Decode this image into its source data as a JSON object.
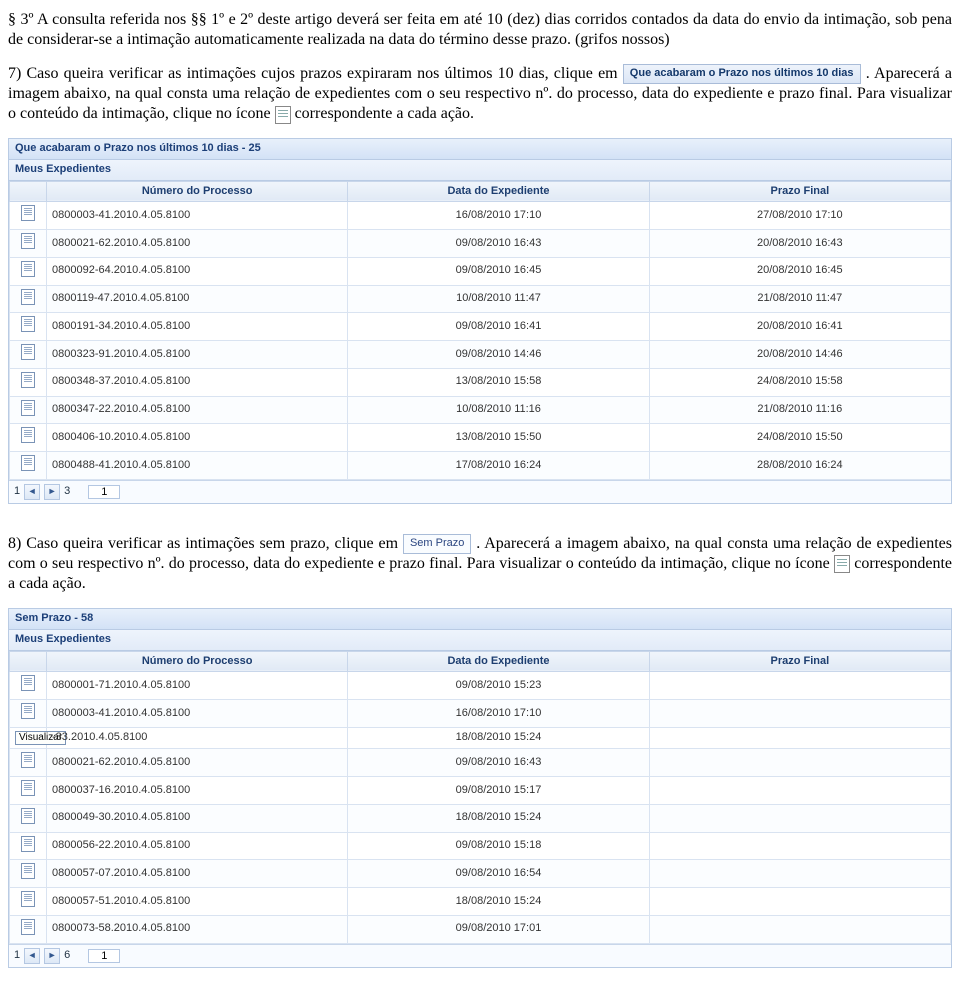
{
  "paragraph1": "§ 3º  A consulta referida nos §§ 1º e 2º deste artigo deverá ser feita em até 10 (dez) dias corridos contados da data do envio da intimação, sob pena de considerar-se a intimação automaticamente realizada na data do término desse prazo. (grifos nossos)",
  "para7_a": "7) Caso queira verificar as intimações cujos prazos expiraram nos últimos 10 dias, clique em ",
  "box_10dias": "Que acabaram o Prazo nos últimos 10 dias",
  "para7_b": ". Aparecerá a imagem abaixo, na qual consta uma relação de expedientes com o seu respectivo nº. do processo, data do expediente e prazo final. Para visualizar o conteúdo da intimação, clique no ícone ",
  "para7_c": " correspondente a cada ação.",
  "panelA": {
    "title": "Que acabaram o Prazo nos últimos 10 dias - 25",
    "sub": "Meus Expedientes",
    "headers": [
      "",
      "Número do Processo",
      "Data do Expediente",
      "Prazo Final"
    ],
    "rows": [
      [
        "0800003-41.2010.4.05.8100",
        "16/08/2010 17:10",
        "27/08/2010 17:10"
      ],
      [
        "0800021-62.2010.4.05.8100",
        "09/08/2010 16:43",
        "20/08/2010 16:43"
      ],
      [
        "0800092-64.2010.4.05.8100",
        "09/08/2010 16:45",
        "20/08/2010 16:45"
      ],
      [
        "0800119-47.2010.4.05.8100",
        "10/08/2010 11:47",
        "21/08/2010 11:47"
      ],
      [
        "0800191-34.2010.4.05.8100",
        "09/08/2010 16:41",
        "20/08/2010 16:41"
      ],
      [
        "0800323-91.2010.4.05.8100",
        "09/08/2010 14:46",
        "20/08/2010 14:46"
      ],
      [
        "0800348-37.2010.4.05.8100",
        "13/08/2010 15:58",
        "24/08/2010 15:58"
      ],
      [
        "0800347-22.2010.4.05.8100",
        "10/08/2010 11:16",
        "21/08/2010 11:16"
      ],
      [
        "0800406-10.2010.4.05.8100",
        "13/08/2010 15:50",
        "24/08/2010 15:50"
      ],
      [
        "0800488-41.2010.4.05.8100",
        "17/08/2010 16:24",
        "28/08/2010 16:24"
      ]
    ],
    "pager": {
      "current": "1",
      "total": "3",
      "input": "1"
    }
  },
  "para8_a": "8) Caso queira verificar as intimações sem prazo, clique em ",
  "box_semprazo": "Sem Prazo",
  "para8_b": ". Aparecerá a imagem abaixo, na qual consta uma relação de expedientes com o seu respectivo nº. do processo, data do expediente e prazo final. Para visualizar o conteúdo da intimação, clique no ícone ",
  "para8_c": " correspondente a cada ação.",
  "panelB": {
    "title": "Sem Prazo - 58",
    "sub": "Meus Expedientes",
    "headers": [
      "",
      "Número do Processo",
      "Data do Expediente",
      "Prazo Final"
    ],
    "tooltip": "Visualizar",
    "rows": [
      [
        "0800001-71.2010.4.05.8100",
        "09/08/2010 15:23",
        ""
      ],
      [
        "0800003-41.2010.4.05.8100",
        "16/08/2010 17:10",
        ""
      ],
      [
        "-33.2010.4.05.8100",
        "18/08/2010 15:24",
        ""
      ],
      [
        "0800021-62.2010.4.05.8100",
        "09/08/2010 16:43",
        ""
      ],
      [
        "0800037-16.2010.4.05.8100",
        "09/08/2010 15:17",
        ""
      ],
      [
        "0800049-30.2010.4.05.8100",
        "18/08/2010 15:24",
        ""
      ],
      [
        "0800056-22.2010.4.05.8100",
        "09/08/2010 15:18",
        ""
      ],
      [
        "0800057-07.2010.4.05.8100",
        "09/08/2010 16:54",
        ""
      ],
      [
        "0800057-51.2010.4.05.8100",
        "18/08/2010 15:24",
        ""
      ],
      [
        "0800073-58.2010.4.05.8100",
        "09/08/2010 17:01",
        ""
      ]
    ],
    "pager": {
      "current": "1",
      "total": "6",
      "input": "1"
    }
  }
}
